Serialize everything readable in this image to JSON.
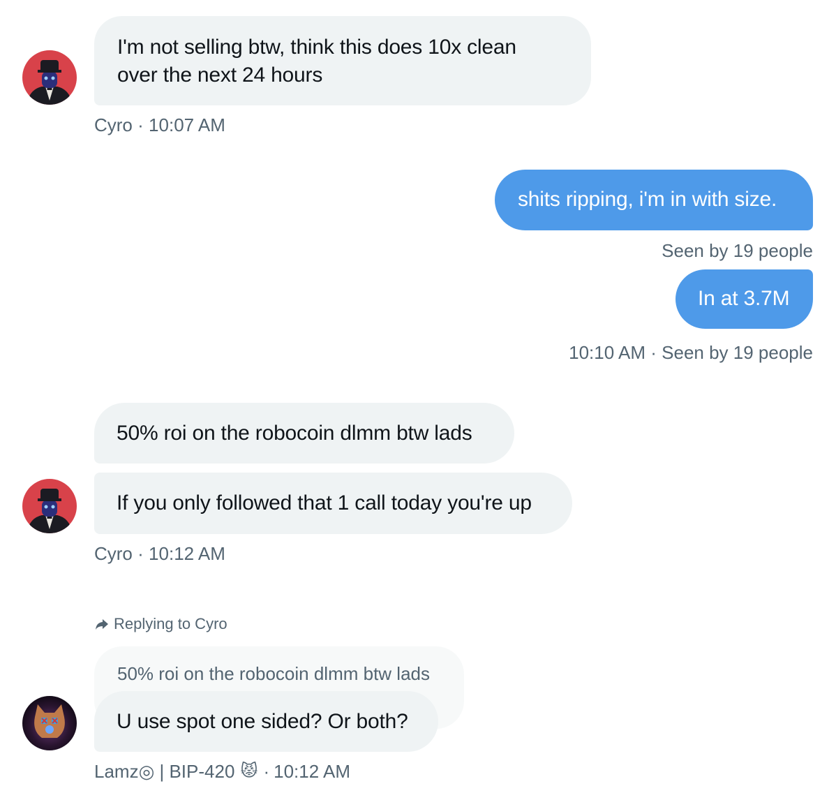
{
  "messages": {
    "m1": {
      "line1": "I'm not selling btw, think this does 10x clean",
      "line2": "over the next 24 hours",
      "sender": "Cyro",
      "time": "10:07 AM"
    },
    "m2": {
      "text": "shits ripping, i'm in with size.",
      "seen": "Seen by 19 people"
    },
    "m3": {
      "text": "In at 3.7M",
      "time": "10:10 AM",
      "seen": "Seen by 19 people"
    },
    "m4": {
      "text": "50% roi on the robocoin dlmm btw lads"
    },
    "m5": {
      "text": "If you only followed that 1 call today you're up",
      "sender": "Cyro",
      "time": "10:12 AM"
    },
    "m6": {
      "replying_to": "Replying to Cyro",
      "quoted": "50% roi on the robocoin dlmm btw lads",
      "text": "U use spot one sided? Or both?",
      "sender": "Lamz◎ | BIP-420",
      "sender_emoji": "😾",
      "time": "10:12 AM"
    }
  },
  "separator": "·",
  "icons": {
    "reply": "reply-arrow-icon"
  },
  "colors": {
    "incoming_bubble": "#eff3f4",
    "outgoing_bubble": "#4e9ae9",
    "meta_text": "#536471"
  }
}
